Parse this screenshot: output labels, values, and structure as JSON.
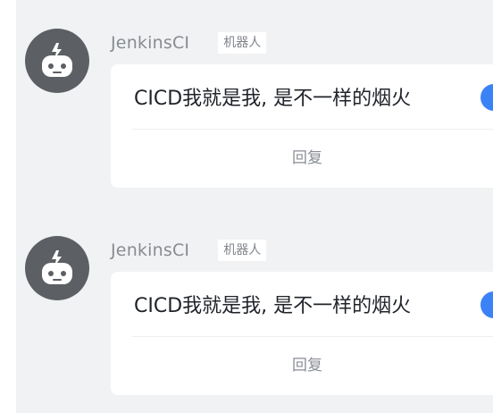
{
  "messages": [
    {
      "sender": "JenkinsCI",
      "tag": "机器人",
      "text": "CICD我就是我, 是不一样的烟火",
      "reply_label": "回复"
    },
    {
      "sender": "JenkinsCI",
      "tag": "机器人",
      "text": "CICD我就是我, 是不一样的烟火",
      "reply_label": "回复"
    }
  ],
  "icons": {
    "avatar": "robot-icon"
  },
  "colors": {
    "background": "#f1f2f4",
    "avatar": "#5c5f64",
    "card": "#ffffff",
    "emoji_accent": "#3b82f6"
  }
}
